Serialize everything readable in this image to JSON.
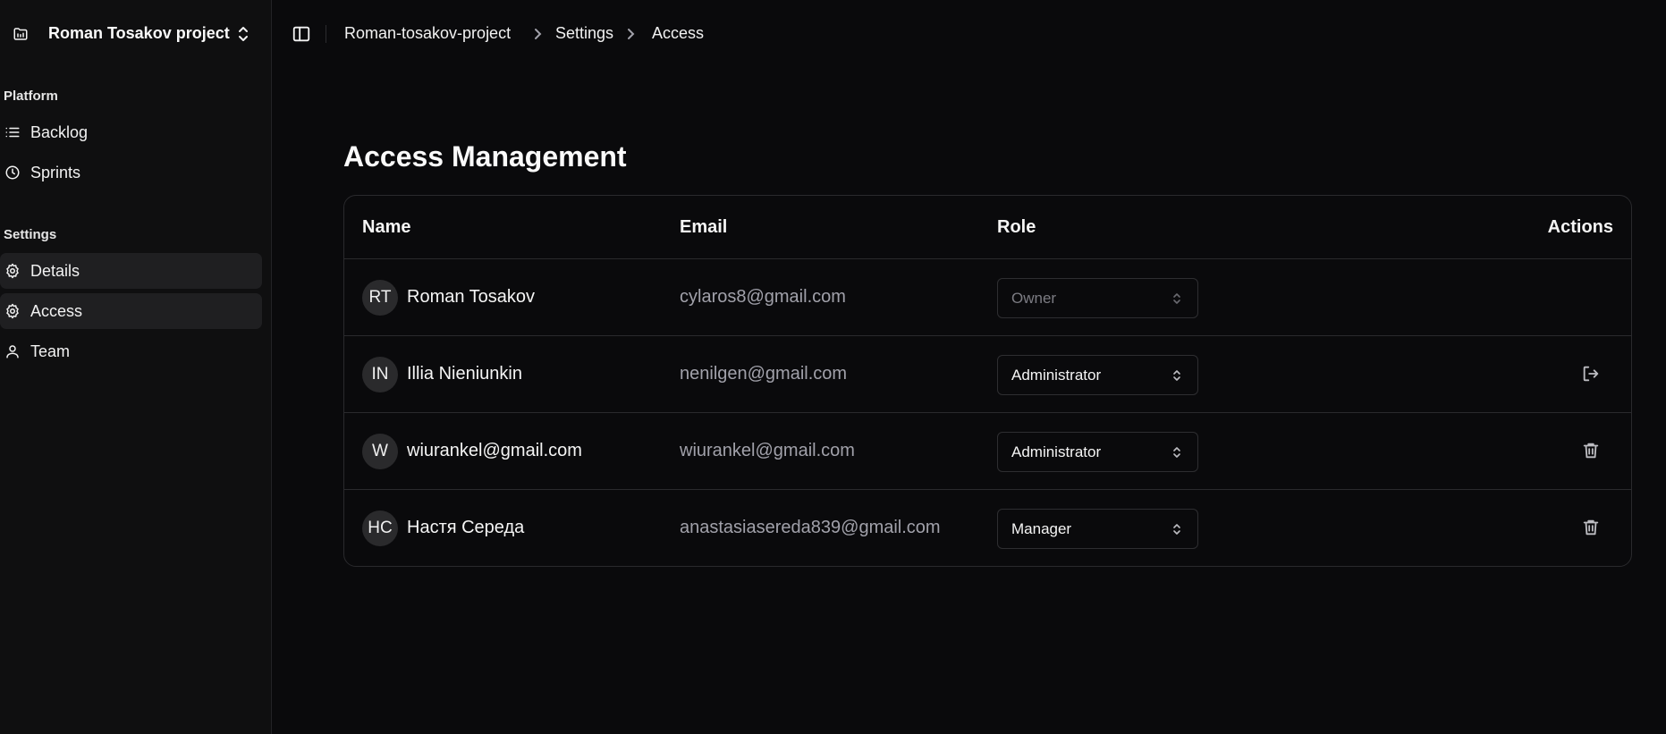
{
  "sidebar": {
    "project_name": "Roman Tosakov project",
    "groups": [
      {
        "label": "Platform",
        "items": [
          {
            "label": "Backlog",
            "icon": "list-icon",
            "active": false
          },
          {
            "label": "Sprints",
            "icon": "clock-icon",
            "active": false
          }
        ]
      },
      {
        "label": "Settings",
        "items": [
          {
            "label": "Details",
            "icon": "gear-icon",
            "active": true
          },
          {
            "label": "Access",
            "icon": "gear-icon",
            "active": true
          },
          {
            "label": "Team",
            "icon": "user-icon",
            "active": false
          }
        ]
      }
    ]
  },
  "breadcrumb": [
    "Roman-tosakov-project",
    "Settings",
    "Access"
  ],
  "page": {
    "title": "Access Management"
  },
  "table": {
    "headers": {
      "name": "Name",
      "email": "Email",
      "role": "Role",
      "actions": "Actions"
    },
    "rows": [
      {
        "initials": "RT",
        "name": "Roman Tosakov",
        "email": "cylaros8@gmail.com",
        "role": "Owner",
        "role_disabled": true,
        "action": ""
      },
      {
        "initials": "IN",
        "name": "Illia Nieniunkin",
        "email": "nenilgen@gmail.com",
        "role": "Administrator",
        "role_disabled": false,
        "action": "leave-icon"
      },
      {
        "initials": "W",
        "name": "wiurankel@gmail.com",
        "email": "wiurankel@gmail.com",
        "role": "Administrator",
        "role_disabled": false,
        "action": "trash-icon"
      },
      {
        "initials": "НС",
        "name": "Настя Середа",
        "email": "anastasiasereda839@gmail.com",
        "role": "Manager",
        "role_disabled": false,
        "action": "trash-icon"
      }
    ]
  },
  "colors": {
    "background": "#0a0a0c",
    "sidebar": "#0f0f10",
    "border": "#2a2a2d",
    "muted_text": "#a1a1aa",
    "active_item": "#1f1f21"
  }
}
